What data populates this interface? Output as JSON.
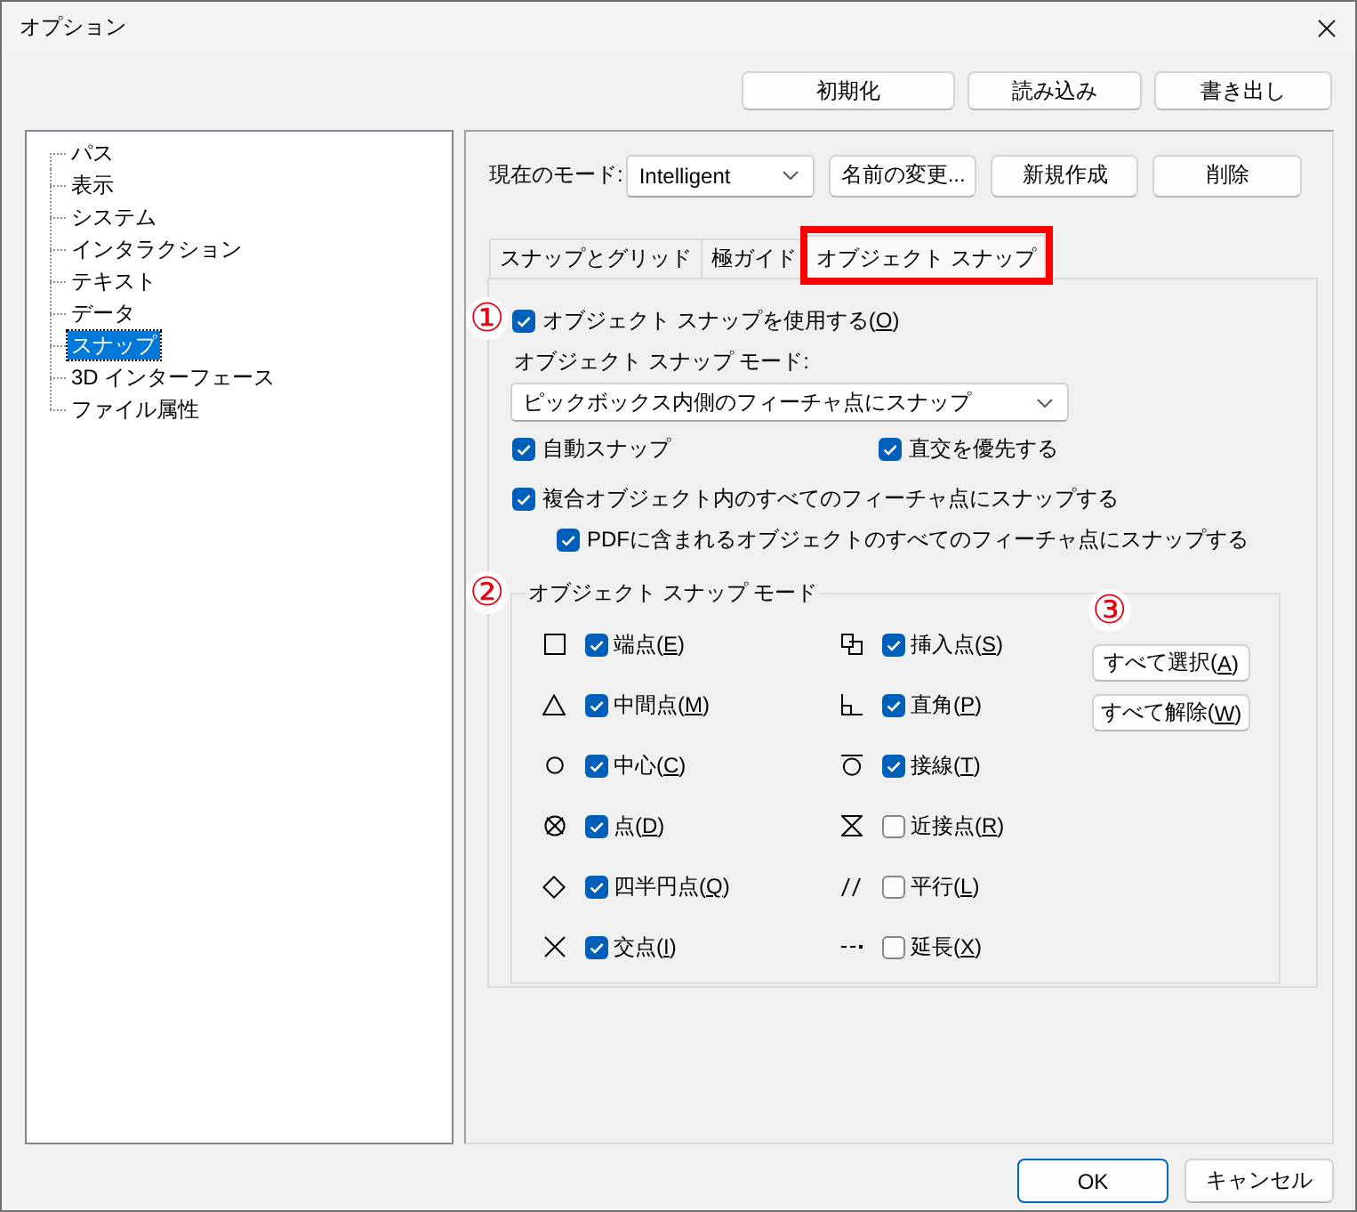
{
  "window": {
    "title": "オプション"
  },
  "top_buttons": [
    "初期化",
    "読み込み",
    "書き出し"
  ],
  "sidebar": {
    "items": [
      {
        "label": "パス",
        "selected": false
      },
      {
        "label": "表示",
        "selected": false
      },
      {
        "label": "システム",
        "selected": false
      },
      {
        "label": "インタラクション",
        "selected": false
      },
      {
        "label": "テキスト",
        "selected": false
      },
      {
        "label": "データ",
        "selected": false
      },
      {
        "label": "スナップ",
        "selected": true
      },
      {
        "label": "3D インターフェース",
        "selected": false
      },
      {
        "label": "ファイル属性",
        "selected": false
      }
    ]
  },
  "mode_bar": {
    "label": "現在のモード:",
    "mode": "Intelligent",
    "buttons": [
      "名前の変更...",
      "新規作成",
      "削除"
    ]
  },
  "tabs": [
    {
      "label": "スナップとグリッド",
      "selected": false,
      "highlighted": false
    },
    {
      "label": "極ガイド",
      "selected": false,
      "highlighted": false
    },
    {
      "label": "オブジェクト スナップ",
      "selected": true,
      "highlighted": true
    }
  ],
  "object_snap": {
    "use_snap": {
      "label": "オブジェクト スナップを使用する(O)",
      "checked": true,
      "callout": "①"
    },
    "mode_label": "オブジェクト スナップ モード:",
    "mode_select": {
      "value": "ピックボックス内側のフィーチャ点にスナップ"
    },
    "options": [
      {
        "label": "自動スナップ",
        "checked": true
      },
      {
        "label": "直交を優先する",
        "checked": true
      }
    ],
    "compound": {
      "label": "複合オブジェクト内のすべてのフィーチャ点にスナップする",
      "checked": true,
      "children": [
        {
          "label": "PDFに含まれるオブジェクトのすべてのフィーチャ点にスナップする",
          "checked": true
        }
      ]
    },
    "modes_group": {
      "title": "オブジェクト スナップ モード",
      "callout": "②",
      "modes": [
        {
          "kind": "endpoint",
          "label": "端点(E)",
          "checked": true
        },
        {
          "kind": "midpoint",
          "label": "中間点(M)",
          "checked": true
        },
        {
          "kind": "center",
          "label": "中心(C)",
          "checked": true
        },
        {
          "kind": "node",
          "label": "点(D)",
          "checked": true
        },
        {
          "kind": "quadrant",
          "label": "四半円点(Q)",
          "checked": true
        },
        {
          "kind": "intersection",
          "label": "交点(I)",
          "checked": true
        },
        {
          "kind": "insertion",
          "label": "挿入点(S)",
          "checked": true
        },
        {
          "kind": "perpendicular",
          "label": "直角(P)",
          "checked": true
        },
        {
          "kind": "tangent",
          "label": "接線(T)",
          "checked": true
        },
        {
          "kind": "nearest",
          "label": "近接点(R)",
          "checked": false
        },
        {
          "kind": "parallel",
          "label": "平行(L)",
          "checked": false
        },
        {
          "kind": "extension",
          "label": "延長(X)",
          "checked": false
        }
      ],
      "buttons_callout": "③",
      "buttons": [
        "すべて選択(A)",
        "すべて解除(W)"
      ]
    }
  },
  "footer_buttons": [
    {
      "label": "OK",
      "default": true
    },
    {
      "label": "キャンセル",
      "default": false
    }
  ]
}
